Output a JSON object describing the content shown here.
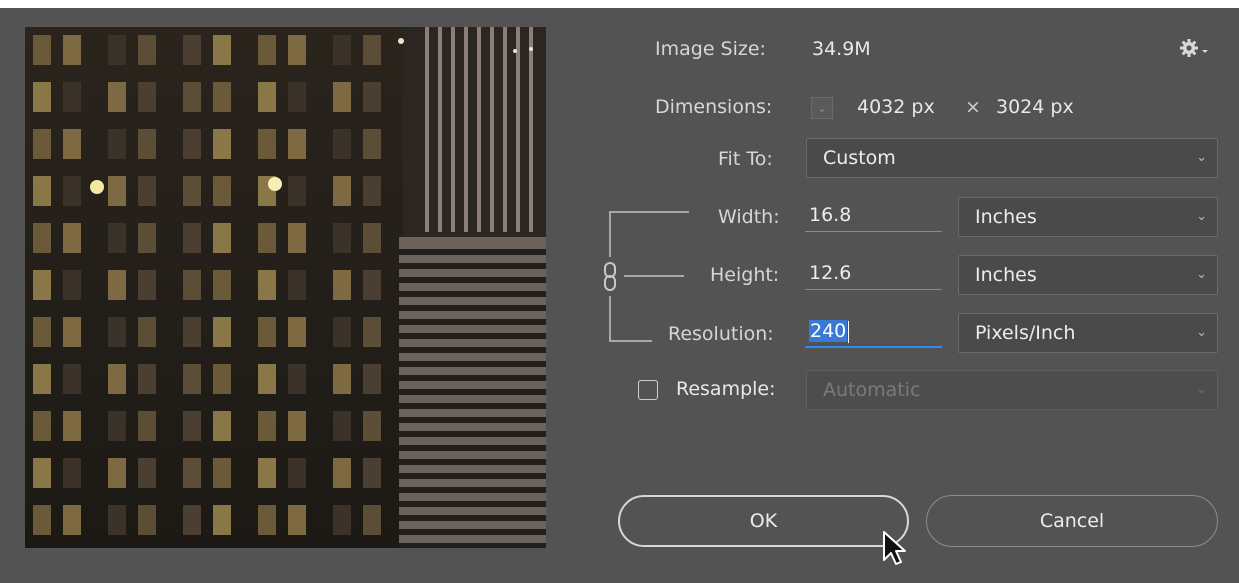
{
  "dialog": {
    "image_size": {
      "label": "Image Size:",
      "value": "34.9M"
    },
    "dimensions": {
      "label": "Dimensions:",
      "width": "4032 px",
      "times": "×",
      "height": "3024 px"
    },
    "fit_to": {
      "label": "Fit To:",
      "value": "Custom"
    },
    "width": {
      "label": "Width:",
      "value": "16.8",
      "unit": "Inches"
    },
    "height": {
      "label": "Height:",
      "value": "12.6",
      "unit": "Inches"
    },
    "resolution": {
      "label": "Resolution:",
      "value": "240",
      "unit": "Pixels/Inch"
    },
    "resample": {
      "label": "Resample:",
      "checked": false,
      "value": "Automatic"
    },
    "buttons": {
      "ok": "OK",
      "cancel": "Cancel"
    }
  },
  "icons": {
    "settings": "gear-icon",
    "chevron": "chevron-down-icon",
    "link": "chain-link-icon",
    "cursor": "mouse-pointer-icon"
  },
  "colors": {
    "dialog_bg": "#535353",
    "selection": "#3878d6",
    "focus_underline": "#2d8ceb"
  }
}
